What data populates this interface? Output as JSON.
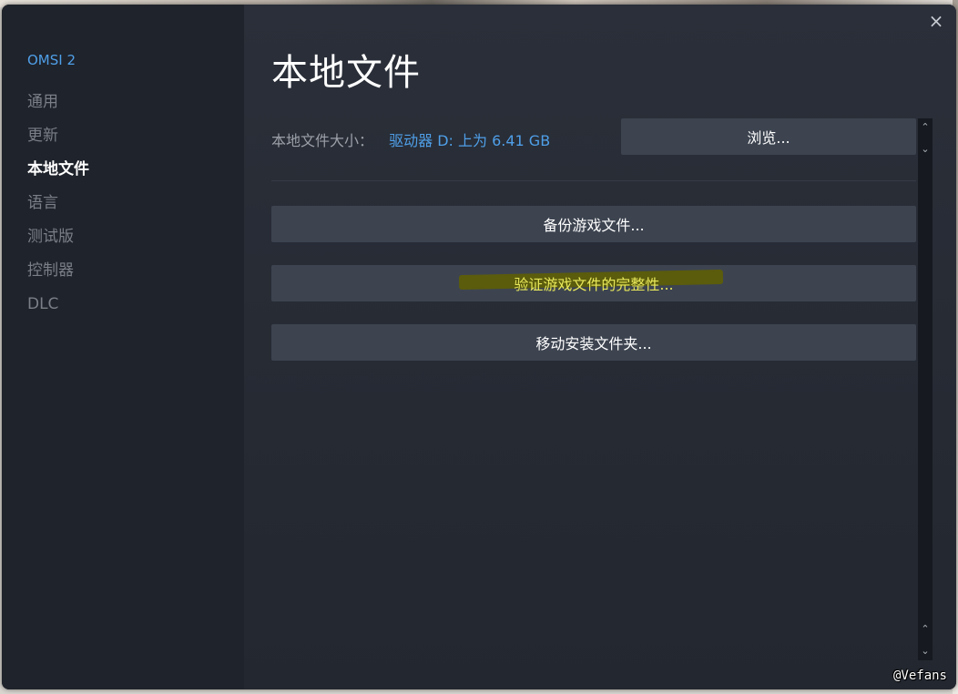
{
  "window": {
    "close_icon": "×"
  },
  "sidebar": {
    "game_title": "OMSI 2",
    "items": [
      {
        "label": "通用"
      },
      {
        "label": "更新"
      },
      {
        "label": "本地文件"
      },
      {
        "label": "语言"
      },
      {
        "label": "测试版"
      },
      {
        "label": "控制器"
      },
      {
        "label": "DLC"
      }
    ],
    "active_index": 2
  },
  "main": {
    "title": "本地文件",
    "size_label": "本地文件大小：",
    "size_value": "驱动器 D: 上为 6.41 GB",
    "browse_label": "浏览...",
    "buttons": {
      "backup": "备份游戏文件...",
      "verify": "验证游戏文件的完整性...",
      "move": "移动安装文件夹..."
    }
  },
  "scrollbar": {
    "up_icon": "⌃",
    "down_icon": "⌄"
  },
  "watermark": "@Vefans",
  "colors": {
    "accent": "#4f9fe8",
    "button_bg": "#3d4450",
    "highlight": "#e8e85a"
  }
}
